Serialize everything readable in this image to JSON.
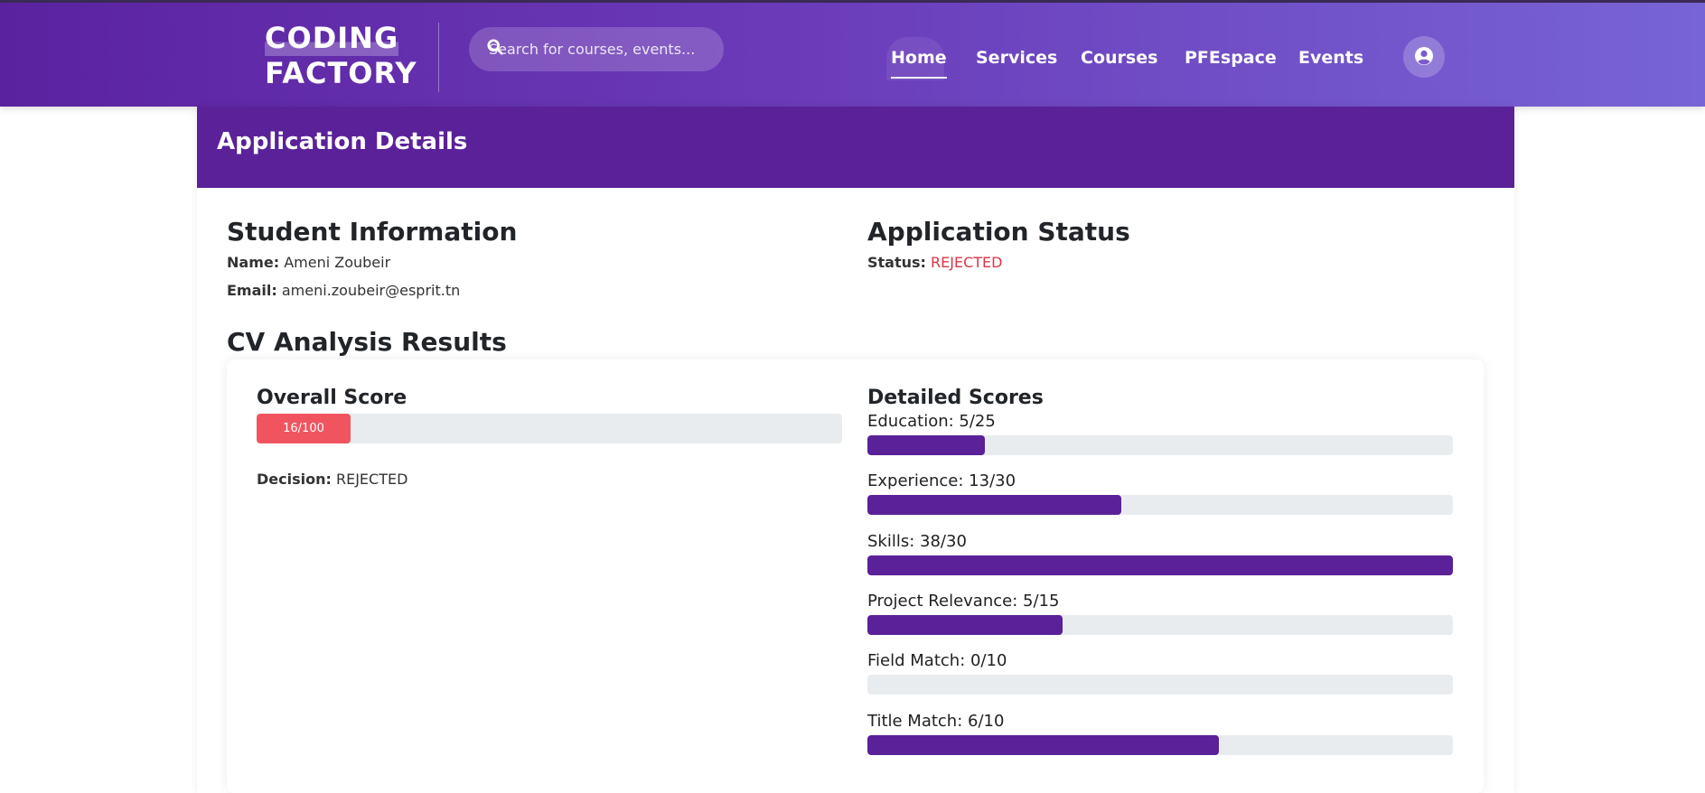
{
  "header": {
    "logo_line1": "CODING",
    "logo_line2": "FACTORY",
    "search_placeholder": "Search for courses, events...",
    "nav": [
      {
        "label": "Home",
        "active": true
      },
      {
        "label": "Services",
        "active": false
      },
      {
        "label": "Courses",
        "active": false
      },
      {
        "label": "PFEspace",
        "active": false
      },
      {
        "label": "Events",
        "active": false
      }
    ],
    "user_icon": "user-circle-icon"
  },
  "page": {
    "title": "Application Details"
  },
  "student": {
    "heading": "Student Information",
    "name_label": "Name:",
    "name": "Ameni Zoubeir",
    "email_label": "Email:",
    "email": "ameni.zoubeir@esprit.tn"
  },
  "application": {
    "heading": "Application Status",
    "status_label": "Status:",
    "status": "REJECTED",
    "status_color": "#dc3545"
  },
  "analysis": {
    "heading": "CV Analysis Results",
    "overall_heading": "Overall Score",
    "overall_label": "16/100",
    "overall_fraction": 0.16,
    "decision_label": "Decision:",
    "decision": "REJECTED",
    "detailed_heading": "Detailed Scores",
    "scores": [
      {
        "label": "Education: 5/25",
        "fraction": 0.2
      },
      {
        "label": "Experience: 13/30",
        "fraction": 0.4333
      },
      {
        "label": "Skills: 38/30",
        "fraction": 1.0
      },
      {
        "label": "Project Relevance: 5/15",
        "fraction": 0.3333
      },
      {
        "label": "Field Match: 0/10",
        "fraction": 0.0
      },
      {
        "label": "Title Match: 6/10",
        "fraction": 0.6
      }
    ],
    "bar_color": "#5a2199",
    "overall_color": "#f0555f"
  }
}
